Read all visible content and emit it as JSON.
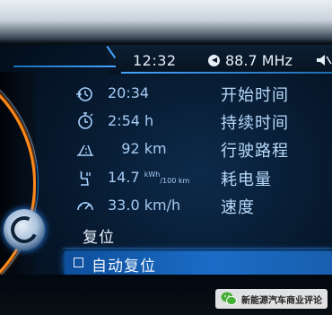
{
  "header": {
    "time": "12:32",
    "radio": "88.7 MHz"
  },
  "trip": [
    {
      "icon": "start-time-icon",
      "value": "20:34",
      "unit": "",
      "label": "开始时间"
    },
    {
      "icon": "stopwatch-icon",
      "value": "2:54",
      "unit": "h",
      "label": "持续时间"
    },
    {
      "icon": "road-distance-icon",
      "value": "92",
      "unit": "km",
      "label": "行驶路程"
    },
    {
      "icon": "charging-icon",
      "value": "14.7",
      "unit_num": "kWh",
      "unit_den": "/100 km",
      "label": "耗电量"
    },
    {
      "icon": "speedometer-icon",
      "value": "33.0",
      "unit": "km/h",
      "label": "速度"
    }
  ],
  "actions": {
    "reset": "复位",
    "auto_reset": "自动复位"
  },
  "watermark": {
    "text": "新能源汽车商业评论"
  },
  "colors": {
    "accent": "#1b6cc6",
    "orange": "#ff8a1c",
    "text": "#b8dafc"
  }
}
